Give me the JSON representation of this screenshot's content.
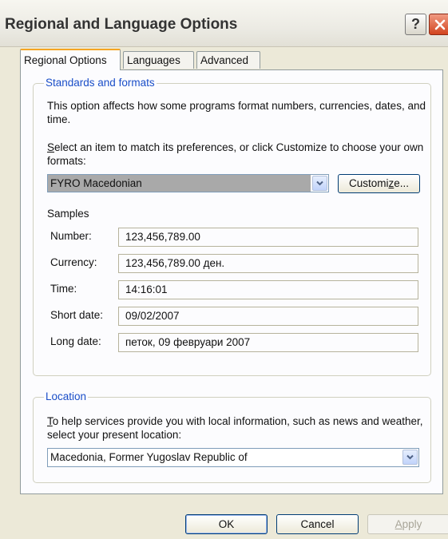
{
  "window": {
    "title": "Regional and Language Options",
    "help_label": "?"
  },
  "tabs": [
    {
      "label": "Regional Options",
      "active": true
    },
    {
      "label": "Languages",
      "active": false
    },
    {
      "label": "Advanced",
      "active": false
    }
  ],
  "standards": {
    "group_label": "Standards and formats",
    "description": "This option affects how some programs format numbers, currencies, dates, and time.",
    "select_prompt_key": "S",
    "select_prompt": "elect an item to match its preferences, or click Customize to choose your own formats:",
    "format_value": "FYRO Macedonian",
    "customize_pre": "Customi",
    "customize_key": "z",
    "customize_post": "e...",
    "samples_label": "Samples",
    "samples": [
      {
        "label": "Number:",
        "value": "123,456,789.00"
      },
      {
        "label": "Currency:",
        "value": "123,456,789.00 ден."
      },
      {
        "label": "Time:",
        "value": "14:16:01"
      },
      {
        "label": "Short date:",
        "value": "09/02/2007"
      },
      {
        "label": "Long date:",
        "value": "петок, 09 февруари 2007"
      }
    ]
  },
  "location": {
    "group_label": "Location",
    "description_key": "T",
    "description": "o help services provide you with local information, such as news and weather, select your present location:",
    "value": "Macedonia, Former Yugoslav Republic of"
  },
  "buttons": {
    "ok": "OK",
    "cancel": "Cancel",
    "apply_key": "A",
    "apply": "pply"
  },
  "colors": {
    "group_label": "#1a4ec8",
    "close_button": "#d2441f",
    "active_tab_accent": "#f5a623",
    "selected_item": "#a9a9a9"
  }
}
